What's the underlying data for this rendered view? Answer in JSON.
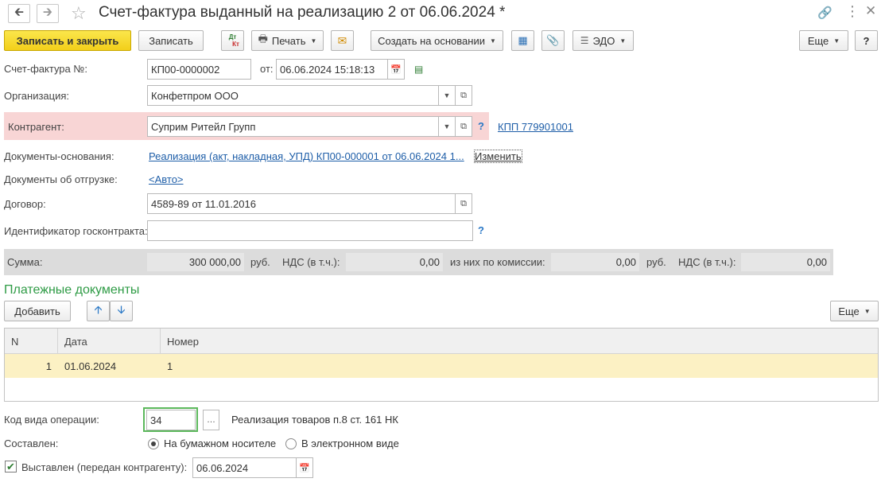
{
  "window": {
    "title": "Счет-фактура выданный на реализацию 2 от 06.06.2024 *"
  },
  "toolbar": {
    "save_close": "Записать и закрыть",
    "save": "Записать",
    "dt_kt_top": "Дт",
    "dt_kt_bottom": "Кт",
    "print": "Печать",
    "create_based": "Создать на основании",
    "edo": "ЭДО",
    "more": "Еще",
    "help": "?"
  },
  "form": {
    "invoice_number_label": "Счет-фактура №:",
    "invoice_number": "КП00-0000002",
    "date_from_label": "от:",
    "date_value": "06.06.2024 15:18:13",
    "organization_label": "Организация:",
    "organization_value": "Конфетпром ООО",
    "counterparty_label": "Контрагент:",
    "counterparty_value": "Суприм Ритейл Групп",
    "kpp_link": "КПП 779901001",
    "basis_docs_label": "Документы-основания:",
    "basis_docs_link": "Реализация (акт, накладная, УПД) КП00-000001 от 06.06.2024 1...",
    "change_link": "Изменить",
    "shipment_docs_label": "Документы об отгрузке:",
    "shipment_docs_link": "<Авто>",
    "contract_label": "Договор:",
    "contract_value": "4589-89 от 11.01.2016",
    "gov_contract_label": "Идентификатор госконтракта:",
    "gov_contract_value": "",
    "help_mark": "?"
  },
  "summary": {
    "sum_label": "Сумма:",
    "sum_value": "300 000,00",
    "currency1": "руб.",
    "vat_label1": "НДС (в т.ч.):",
    "vat_value1": "0,00",
    "commission_label": "из них по комиссии:",
    "commission_value": "0,00",
    "currency2": "руб.",
    "vat_label2": "НДС (в т.ч.):",
    "vat_value2": "0,00"
  },
  "payments": {
    "section_title": "Платежные документы",
    "add_button": "Добавить",
    "more_button": "Еще",
    "columns": [
      "N",
      "Дата",
      "Номер"
    ],
    "rows": [
      {
        "n": "1",
        "date": "01.06.2024",
        "number": "1"
      }
    ]
  },
  "bottom": {
    "op_code_label": "Код вида операции:",
    "op_code_value": "34",
    "op_code_desc": "Реализация товаров п.8 ст. 161 НК",
    "composed_label": "Составлен:",
    "paper_option": "На бумажном носителе",
    "electronic_option": "В электронном виде",
    "issued_label": "Выставлен (передан контрагенту):",
    "issued_date": "06.06.2024"
  },
  "colors": {
    "primary_button": "#f2cf1a",
    "counterparty_highlight": "#f8d5d5",
    "selected_row": "#fcf1c4",
    "section_title": "#2e9b45",
    "op_code_focus": "#5cb85c",
    "link": "#1e5ea8"
  }
}
